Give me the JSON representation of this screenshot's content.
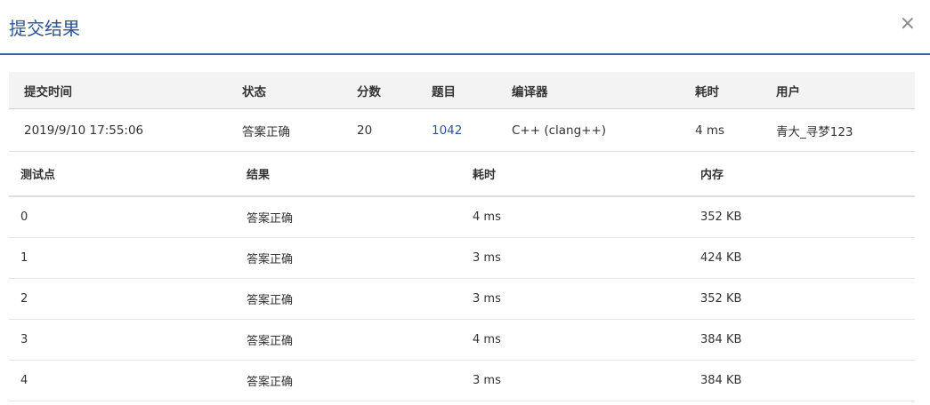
{
  "dialog": {
    "title": "提交结果",
    "close_glyph": "×"
  },
  "summary": {
    "headers": [
      "提交时间",
      "状态",
      "分数",
      "题目",
      "编译器",
      "耗时",
      "用户"
    ],
    "row": {
      "time": "2019/9/10 17:55:06",
      "status": "答案正确",
      "score": "20",
      "problem": "1042",
      "compiler": "C++ (clang++)",
      "elapsed": "4 ms",
      "user": "青大_寻梦123"
    }
  },
  "cases": {
    "headers": [
      "测试点",
      "结果",
      "耗时",
      "内存"
    ],
    "rows": [
      {
        "point": "0",
        "result": "答案正确",
        "time": "4 ms",
        "memory": "352 KB"
      },
      {
        "point": "1",
        "result": "答案正确",
        "time": "3 ms",
        "memory": "424 KB"
      },
      {
        "point": "2",
        "result": "答案正确",
        "time": "3 ms",
        "memory": "352 KB"
      },
      {
        "point": "3",
        "result": "答案正确",
        "time": "4 ms",
        "memory": "384 KB"
      },
      {
        "point": "4",
        "result": "答案正确",
        "time": "3 ms",
        "memory": "384 KB"
      }
    ]
  },
  "colors": {
    "accent": "#2f5597",
    "accepted": "#e0473a"
  }
}
